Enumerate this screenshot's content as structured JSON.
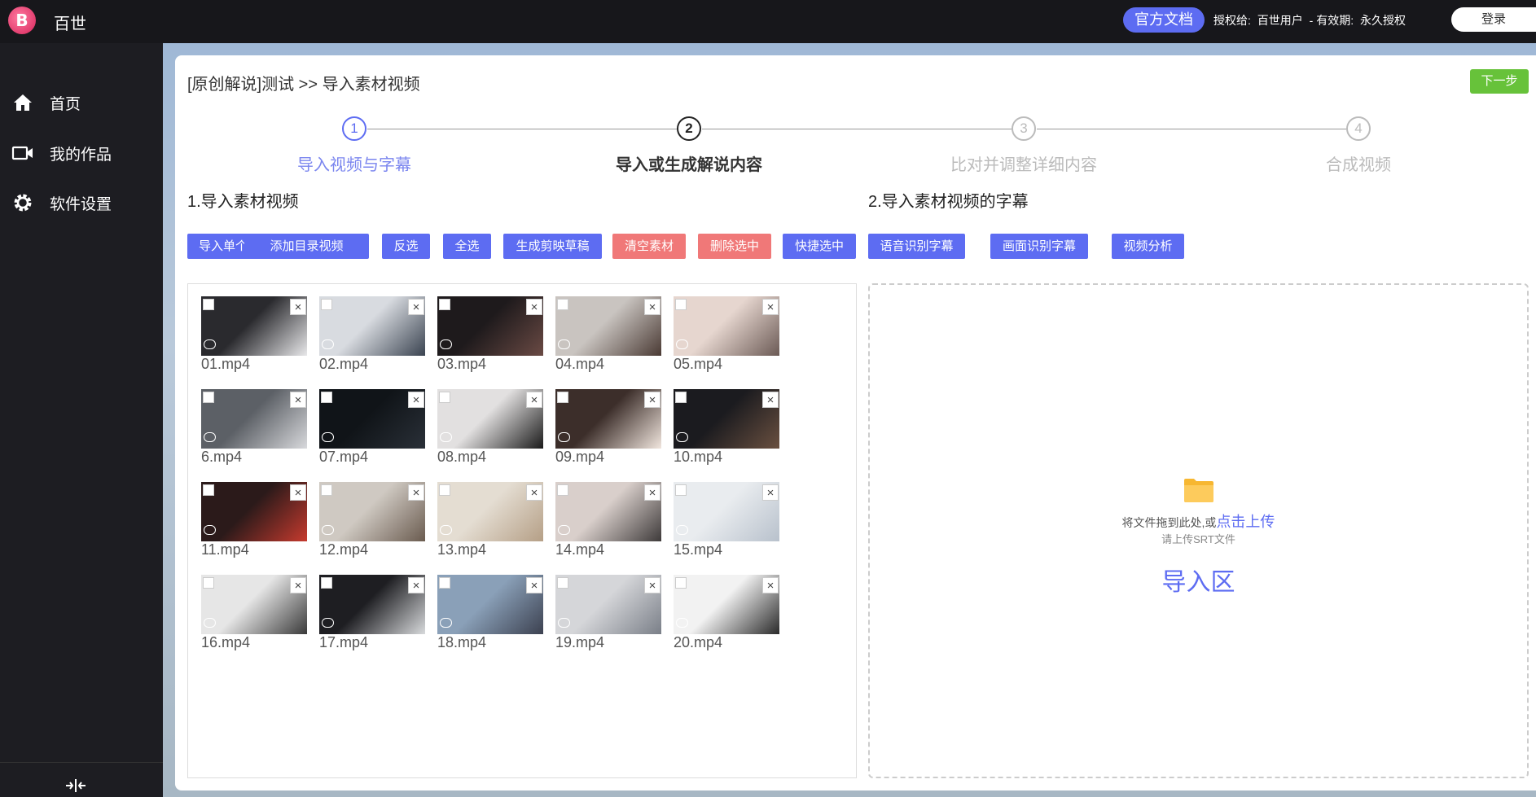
{
  "app": {
    "logo_letter": "B",
    "name": "百世"
  },
  "header": {
    "docs_label": "官方文档",
    "license_label": "授权给:",
    "license_user": "百世用户",
    "validity_label": "- 有效期:",
    "validity_value": "永久授权",
    "login_label": "登录"
  },
  "sidebar": {
    "items": [
      {
        "label": "首页",
        "icon": "home-icon"
      },
      {
        "label": "我的作品",
        "icon": "video-camera-icon"
      },
      {
        "label": "软件设置",
        "icon": "gear-icon"
      }
    ],
    "collapse_icon": "collapse-icon"
  },
  "main": {
    "breadcrumb": "[原创解说]测试 >> 导入素材视频",
    "next_label": "下一步",
    "steps": [
      {
        "num": "1",
        "label": "导入视频与字幕",
        "state": "active"
      },
      {
        "num": "2",
        "label": "导入或生成解说内容",
        "state": "current"
      },
      {
        "num": "3",
        "label": "比对并调整详细内容",
        "state": "pending"
      },
      {
        "num": "4",
        "label": "合成视频",
        "state": "pending"
      }
    ],
    "section1_title": "1.导入素材视频",
    "section2_title": "2.导入素材视频的字幕",
    "toolbar": [
      {
        "label": "导入单个",
        "color": "blue"
      },
      {
        "label": "添加目录视频",
        "color": "blue"
      },
      {
        "label": "反选",
        "color": "blue"
      },
      {
        "label": "全选",
        "color": "blue"
      },
      {
        "label": "生成剪映草稿",
        "color": "blue"
      },
      {
        "label": "清空素材",
        "color": "red"
      },
      {
        "label": "删除选中",
        "color": "red"
      },
      {
        "label": "快捷选中",
        "color": "blue"
      },
      {
        "label": "语音识别字幕",
        "color": "blue"
      },
      {
        "label": "画面识别字幕",
        "color": "blue"
      },
      {
        "label": "视频分析",
        "color": "blue"
      }
    ],
    "videos": [
      "01.mp4",
      "02.mp4",
      "03.mp4",
      "04.mp4",
      "05.mp4",
      "6.mp4",
      "07.mp4",
      "08.mp4",
      "09.mp4",
      "10.mp4",
      "11.mp4",
      "12.mp4",
      "13.mp4",
      "14.mp4",
      "15.mp4",
      "16.mp4",
      "17.mp4",
      "18.mp4",
      "19.mp4",
      "20.mp4"
    ],
    "close_glyph": "×",
    "dropzone": {
      "text": "将文件拖到此处,或",
      "link": "点击上传",
      "hint": "请上传SRT文件",
      "label": "导入区",
      "icon": "folder-icon"
    }
  },
  "colors": {
    "accent": "#5d6cf2",
    "danger": "#f07878",
    "success": "#67c23a"
  }
}
